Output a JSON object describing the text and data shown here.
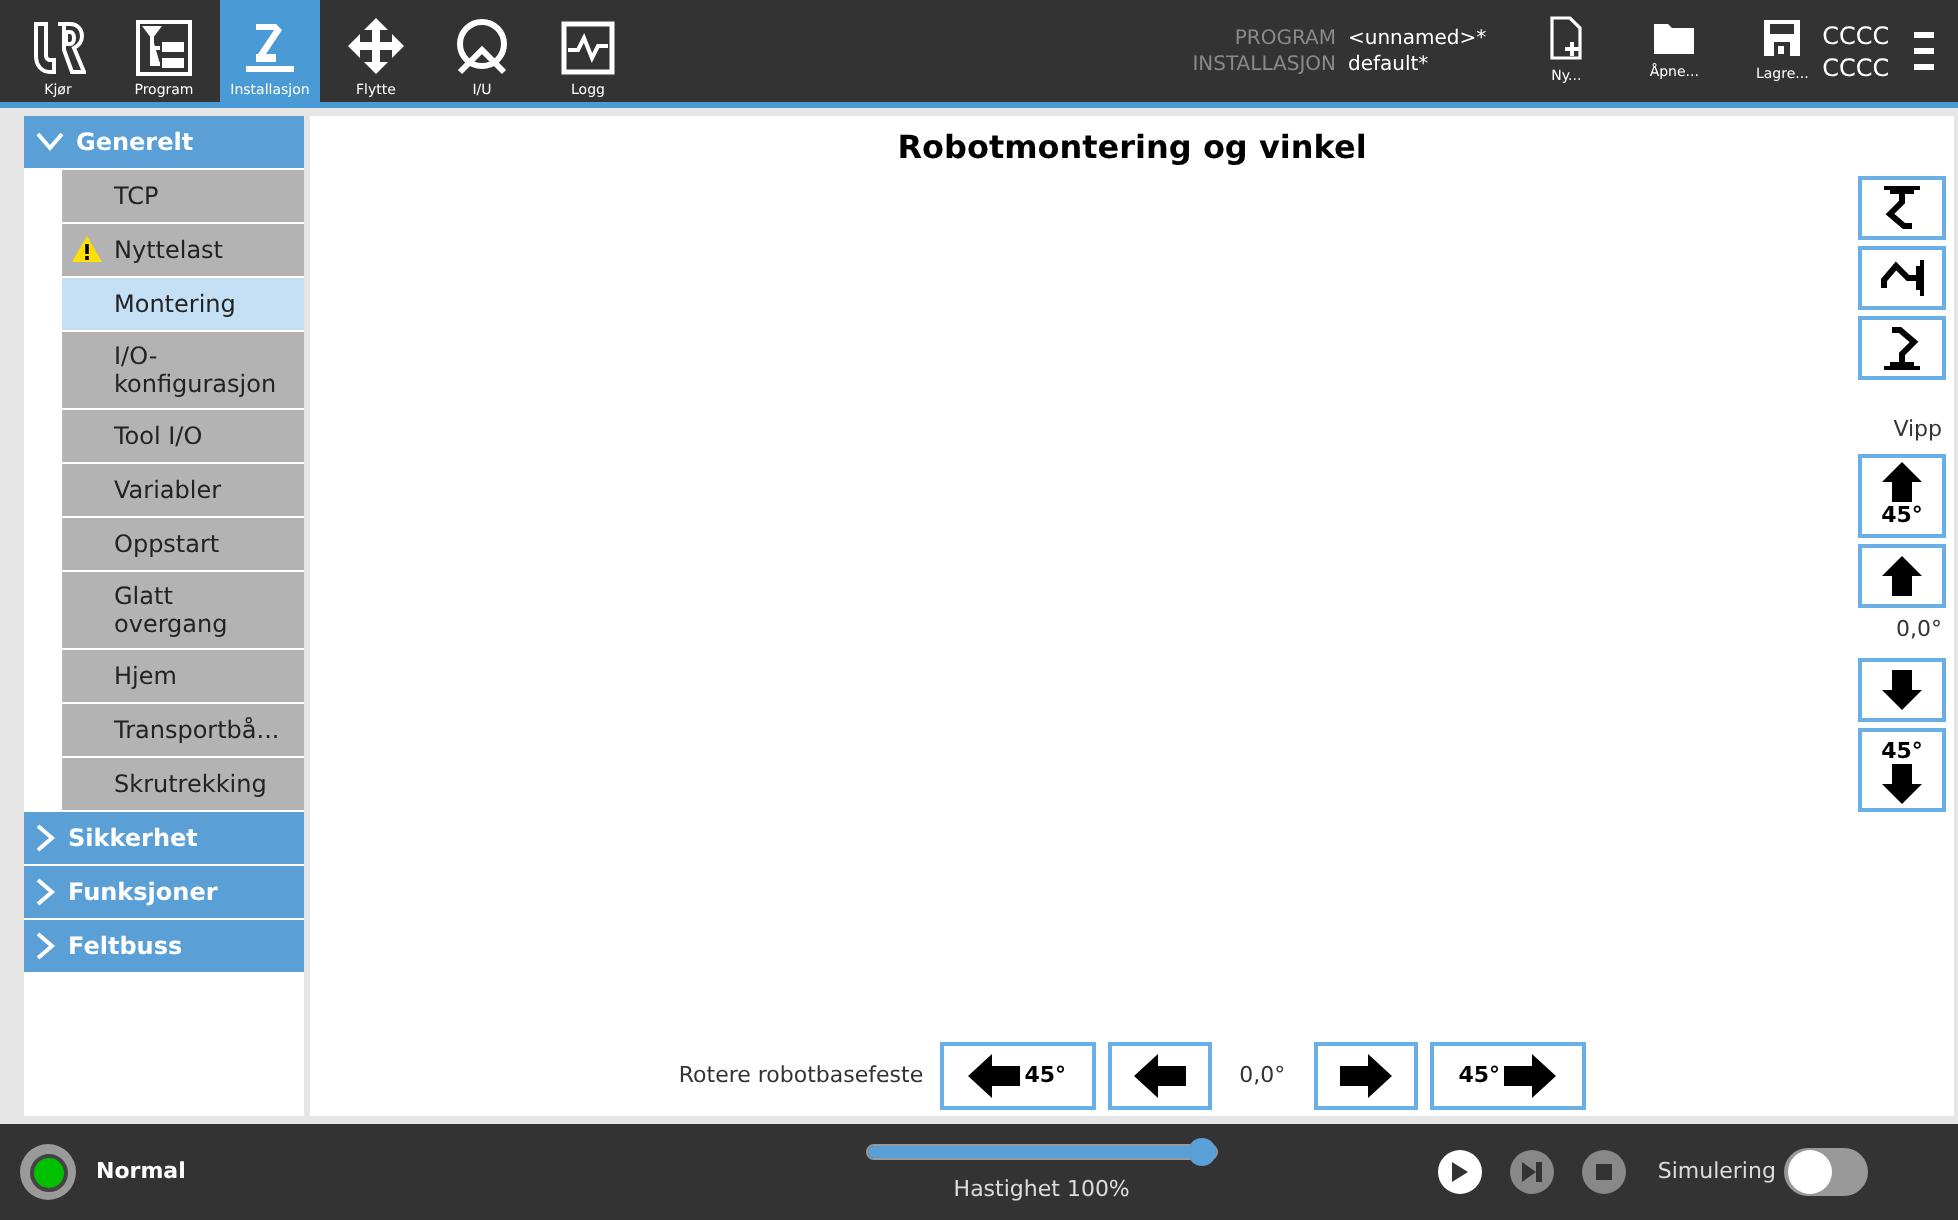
{
  "nav_tabs": [
    {
      "label": "Kjør",
      "selected": false
    },
    {
      "label": "Program",
      "selected": false
    },
    {
      "label": "Installasjon",
      "selected": true
    },
    {
      "label": "Flytte",
      "selected": false
    },
    {
      "label": "I/U",
      "selected": false
    },
    {
      "label": "Logg",
      "selected": false
    }
  ],
  "file_info": [
    {
      "label": "PROGRAM",
      "value": "<unnamed>*"
    },
    {
      "label": "INSTALLASJON",
      "value": "default*"
    }
  ],
  "file_buttons": [
    {
      "label": "Ny..."
    },
    {
      "label": "Åpne..."
    },
    {
      "label": "Lagre..."
    }
  ],
  "user": [
    "CCCC",
    "CCCC"
  ],
  "sidebar": [
    {
      "label": "Generelt",
      "expanded": true,
      "children": [
        {
          "label": "TCP",
          "selected": false,
          "warning": false
        },
        {
          "label": "Nyttelast",
          "selected": false,
          "warning": true
        },
        {
          "label": "Montering",
          "selected": true,
          "warning": false
        },
        {
          "label": "I/O-\nkonfigurasjon",
          "selected": false,
          "warning": false
        },
        {
          "label": "Tool I/O",
          "selected": false,
          "warning": false
        },
        {
          "label": "Variabler",
          "selected": false,
          "warning": false
        },
        {
          "label": "Oppstart",
          "selected": false,
          "warning": false
        },
        {
          "label": "Glatt\novergang",
          "selected": false,
          "warning": false
        },
        {
          "label": "Hjem",
          "selected": false,
          "warning": false
        },
        {
          "label": "Transportbå...",
          "selected": false,
          "warning": false
        },
        {
          "label": "Skrutrekking",
          "selected": false,
          "warning": false
        }
      ]
    },
    {
      "label": "Sikkerhet",
      "expanded": false
    },
    {
      "label": "Funksjoner",
      "expanded": false
    },
    {
      "label": "Feltbuss",
      "expanded": false
    }
  ],
  "title": "Robotmontering og vinkel",
  "mount_buttons": [
    {
      "kind": "ceiling"
    },
    {
      "kind": "wall"
    },
    {
      "kind": "floor"
    }
  ],
  "tilt": {
    "label": "Vipp",
    "reading": "0,0°",
    "buttons": [
      {
        "kind": "up",
        "step": "45°"
      },
      {
        "kind": "up"
      },
      {
        "kind": "down"
      },
      {
        "kind": "down",
        "step": "45°"
      }
    ]
  },
  "rotate": {
    "label": "Rotere robotbasefeste",
    "reading": "0,0°",
    "buttons": [
      {
        "kind": "left",
        "step": "45°"
      },
      {
        "kind": "left"
      },
      {
        "kind": "right"
      },
      {
        "kind": "right",
        "step": "45°"
      }
    ]
  },
  "status": {
    "label": "Normal",
    "color": "#00c000"
  },
  "speed": {
    "label": "Hastighet 100%",
    "level": 1.0
  },
  "simulation": {
    "label": "Simulering",
    "on": false
  }
}
